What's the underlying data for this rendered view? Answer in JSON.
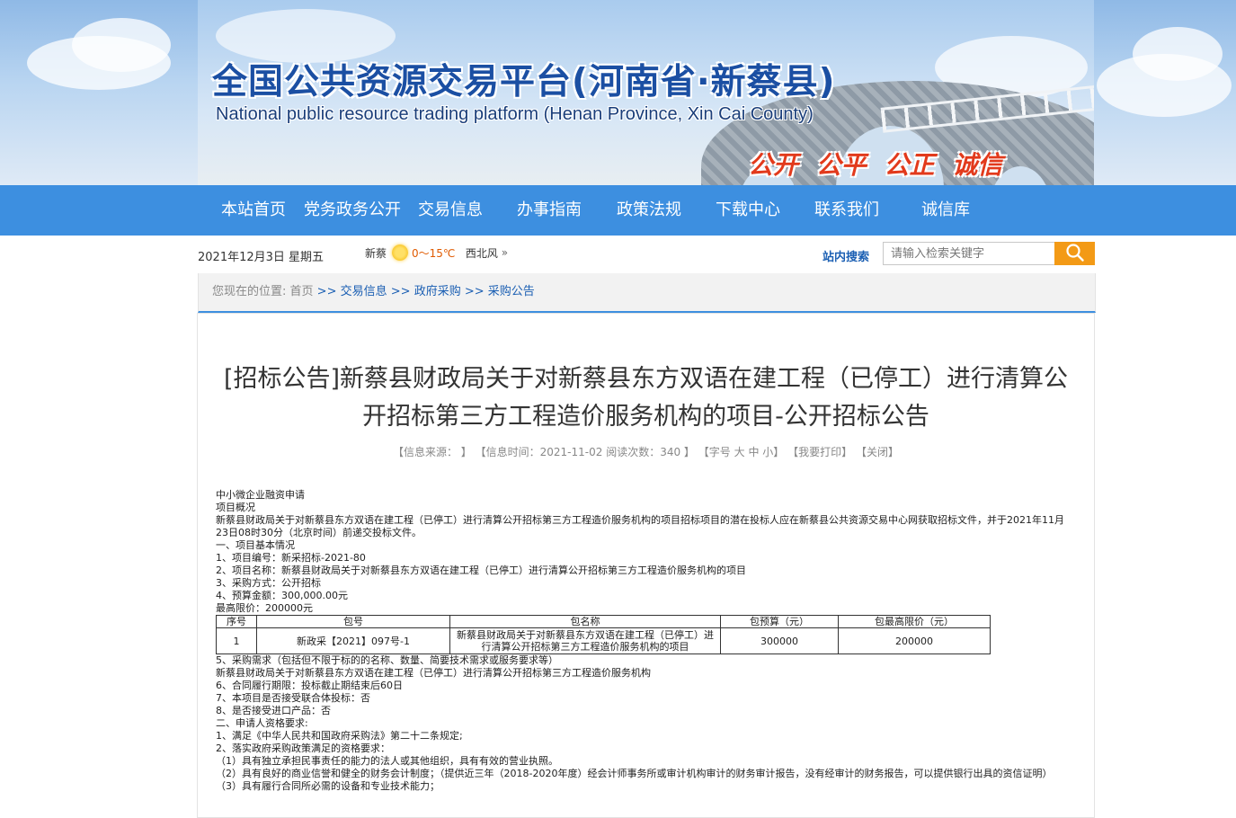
{
  "banner": {
    "title": "全国公共资源交易平台(河南省·新蔡县)",
    "subtitle": "National public resource trading platform (Henan Province, Xin Cai County)",
    "slogan": "公开 公平 公正 诚信"
  },
  "nav": {
    "items": [
      "本站首页",
      "党务政务公开",
      "交易信息",
      "办事指南",
      "政策法规",
      "下载中心",
      "联系我们",
      "诚信库"
    ]
  },
  "infobar": {
    "date": "2021年12月3日 星期五",
    "city": "新蔡",
    "temp": "0～15℃",
    "wind": "西北风",
    "more": "»",
    "search_label": "站内搜索",
    "search_placeholder": "请输入检索关键字",
    "search_icon": "search-icon"
  },
  "breadcrumb": {
    "label": "您现在的位置:",
    "items": [
      "首页",
      "交易信息",
      "政府采购",
      "采购公告"
    ],
    "sep": " >> "
  },
  "article": {
    "title": "[招标公告]新蔡县财政局关于对新蔡县东方双语在建工程（已停工）进行清算公开招标第三方工程造价服务机构的项目-公开招标公告",
    "meta": {
      "source": "【信息来源： 】",
      "time": "【信息时间：2021-11-02 阅读次数：340 】",
      "font_open": "【字号",
      "font_large": "大",
      "font_mid": "中",
      "font_small": "小",
      "font_close": "】",
      "print": "【我要打印】",
      "close": "【关闭】"
    },
    "lines_top": [
      "中小微企业融资申请",
      "项目概况",
      "新蔡县财政局关于对新蔡县东方双语在建工程（已停工）进行清算公开招标第三方工程造价服务机构的项目招标项目的潜在投标人应在新蔡县公共资源交易中心网获取招标文件，并于2021年11月23日08时30分（北京时间）前递交投标文件。",
      "一、项目基本情况",
      "1、项目编号：新采招标-2021-80",
      "2、项目名称：新蔡县财政局关于对新蔡县东方双语在建工程（已停工）进行清算公开招标第三方工程造价服务机构的项目",
      "3、采购方式：公开招标",
      "4、预算金额：300,000.00元",
      "最高限价：200000元"
    ],
    "table": {
      "headers": [
        "序号",
        "包号",
        "包名称",
        "包预算（元）",
        "包最高限价（元）"
      ],
      "rows": [
        [
          "1",
          "新政采【2021】097号-1",
          "新蔡县财政局关于对新蔡县东方双语在建工程（已停工）进行清算公开招标第三方工程造价服务机构的项目",
          "300000",
          "200000"
        ]
      ]
    },
    "lines_bottom": [
      "5、采购需求（包括但不限于标的的名称、数量、简要技术需求或服务要求等）",
      "新蔡县财政局关于对新蔡县东方双语在建工程（已停工）进行清算公开招标第三方工程造价服务机构",
      "6、合同履行期限：投标截止期结束后60日",
      "7、本项目是否接受联合体投标：否",
      "8、是否接受进口产品：否",
      "二、申请人资格要求:",
      "1、满足《中华人民共和国政府采购法》第二十二条规定;",
      "2、落实政府采购政策满足的资格要求：",
      "（1）具有独立承担民事责任的能力的法人或其他组织，具有有效的营业执照。",
      "（2）具有良好的商业信誉和健全的财务会计制度；（提供近三年（2018-2020年度）经会计师事务所或审计机构审计的财务审计报告，没有经审计的财务报告，可以提供银行出具的资信证明）",
      "（3）具有履行合同所必需的设备和专业技术能力；"
    ]
  }
}
